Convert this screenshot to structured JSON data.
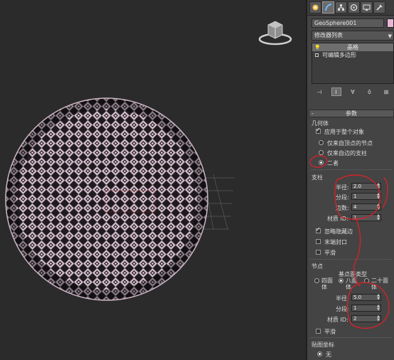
{
  "viewport": {
    "view_cube_icon": "view-cube-icon"
  },
  "panel": {
    "tabs": [
      {
        "icon": "create-icon",
        "active": false
      },
      {
        "icon": "modify-icon",
        "active": true
      },
      {
        "icon": "hierarchy-icon",
        "active": false
      },
      {
        "icon": "motion-icon",
        "active": false
      },
      {
        "icon": "display-icon",
        "active": false
      },
      {
        "icon": "utilities-icon",
        "active": false
      }
    ],
    "object_name": "GeoSphere001",
    "object_color": "#e8b7d4",
    "modifier_list": "修改器列表",
    "stack": [
      {
        "label": "晶格",
        "selected": true
      },
      {
        "label": "可编辑多边形",
        "selected": false
      }
    ],
    "parameters": {
      "title": "参数",
      "geometry_label": "几何体",
      "apply_whole": "应用于整个对象",
      "radio_vertices": "仅来自顶点的节点",
      "radio_edges": "仅来自边的支柱",
      "radio_both": "二者",
      "struts": {
        "label": "支柱",
        "radius_label": "半径:",
        "radius_value": "2.0",
        "segments_label": "分段:",
        "segments_value": "1",
        "sides_label": "边数:",
        "sides_value": "4",
        "material_label": "材质 ID:",
        "material_value": "1",
        "ignore_hidden": "忽略隐藏边",
        "end_caps": "末端封口",
        "smooth": "平滑"
      },
      "joints": {
        "label": "节点",
        "type_label": "基点面类型",
        "opt_tetra": "四面体",
        "opt_octa": "八面体",
        "opt_icosa": "二十面体",
        "radius_label": "半径:",
        "radius_value": "5.0",
        "segments_label": "分段:",
        "segments_value": "1",
        "material_label": "材质 ID:",
        "material_value": "2",
        "smooth": "平滑"
      },
      "mapping": {
        "label": "贴图坐标",
        "none": "无"
      }
    }
  },
  "colors": {
    "lattice_fill": "#dcc6d4",
    "annotation": "#d0242a"
  }
}
